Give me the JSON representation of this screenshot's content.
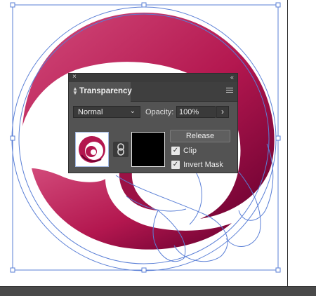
{
  "canvas": {
    "artwork_colors": {
      "primary": "#b3174f",
      "dark": "#6a0030",
      "light": "#d24a7a"
    },
    "path_color": "#5a7fd6"
  },
  "panel": {
    "close_glyph": "×",
    "collapse_glyph": "‹‹",
    "title": "Transparency",
    "tab_icon": "updown-arrows-icon",
    "menu_icon": "hamburger-menu-icon",
    "blend_mode": "Normal",
    "opacity_label": "Opacity:",
    "opacity_value": "100%",
    "opacity_arrow": "›",
    "release_label": "Release",
    "clip_label": "Clip",
    "clip_checked": true,
    "invert_label": "Invert Mask",
    "invert_checked": true,
    "check_glyph": "✓"
  }
}
